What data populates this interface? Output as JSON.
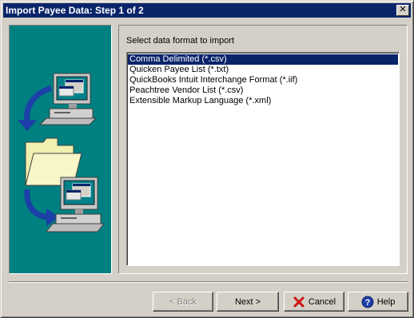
{
  "window": {
    "title": "Import Payee Data: Step 1 of 2",
    "close_glyph": "✕"
  },
  "main": {
    "prompt": "Select data format to import",
    "formats": [
      {
        "label": "Comma Delimited (*.csv)",
        "selected": true
      },
      {
        "label": "Quicken Payee List (*.txt)",
        "selected": false
      },
      {
        "label": "QuickBooks Intuit Interchange Format (*.iif)",
        "selected": false
      },
      {
        "label": "Peachtree Vendor List (*.csv)",
        "selected": false
      },
      {
        "label": "Extensible Markup Language (*.xml)",
        "selected": false
      }
    ]
  },
  "buttons": {
    "back": {
      "label": "< Back",
      "enabled": false
    },
    "next": {
      "label": "Next >",
      "enabled": true
    },
    "cancel": {
      "label": "Cancel",
      "icon": "x-icon",
      "enabled": true
    },
    "help": {
      "label": "Help",
      "icon": "help-icon",
      "enabled": true
    }
  },
  "colors": {
    "titlebar": "#0a246a",
    "side_panel": "#008080",
    "selection": "#0a246a",
    "arrow": "#1c3fa8",
    "folder": "#f2f0b0",
    "cancel_x": "#cc1010"
  }
}
